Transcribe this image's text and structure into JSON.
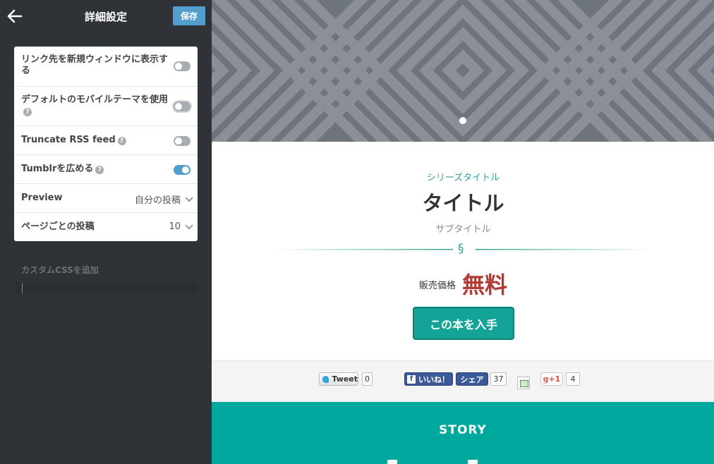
{
  "sidebar": {
    "title": "詳細設定",
    "save_label": "保存",
    "settings": [
      {
        "label": "リンク先を新規ウィンドウに表示する",
        "type": "toggle",
        "on": false
      },
      {
        "label": "デフォルトのモバイルテーマを使用",
        "type": "toggle",
        "on": false,
        "help": true
      },
      {
        "label": "Truncate RSS feed",
        "type": "toggle",
        "on": false,
        "help": true
      },
      {
        "label": "Tumblrを広める",
        "type": "toggle",
        "on": true,
        "help": true
      },
      {
        "label": "Preview",
        "type": "select",
        "value": "自分の投稿"
      },
      {
        "label": "ページごとの投稿",
        "type": "select",
        "value": "10"
      }
    ],
    "custom_css_label": "カスタムCSSを追加",
    "help_glyph": "?"
  },
  "preview": {
    "series_title": "シリーズタイトル",
    "title": "タイトル",
    "subtitle": "サブタイトル",
    "divider_glyph": "§",
    "price_label": "販売価格",
    "price_value": "無料",
    "get_button": "この本を入手",
    "share": {
      "tweet_label": "Tweet",
      "tweet_count": "0",
      "fb_like_label": "いいね！",
      "fb_share_label": "シェア",
      "fb_count": "37",
      "gplus_label": "+1",
      "gplus_count": "4"
    },
    "story_heading": "STORY"
  },
  "colors": {
    "sidebar_bg": "#2f3338",
    "accent_blue": "#529ecc",
    "teal": "#00a99b",
    "price_red": "#b23a35"
  }
}
